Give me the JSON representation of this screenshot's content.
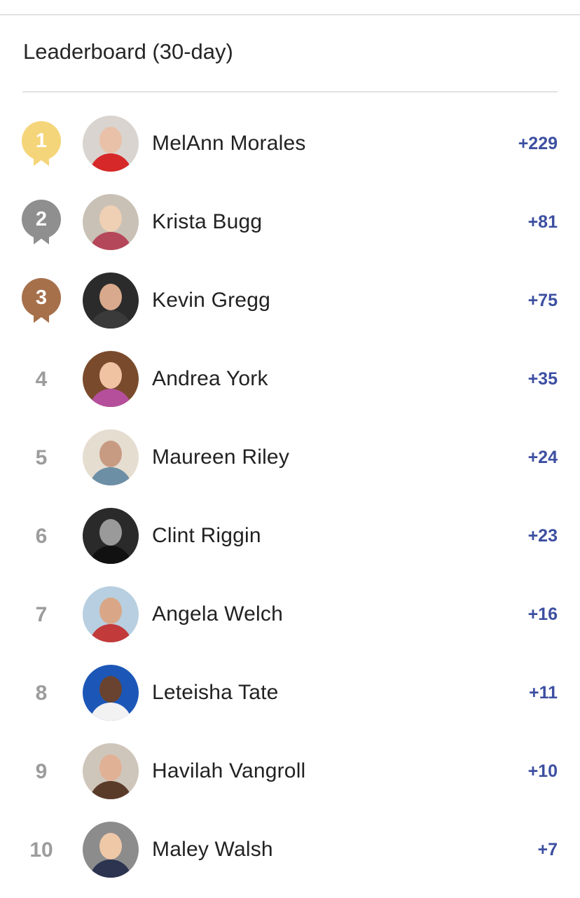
{
  "leaderboard": {
    "title": "Leaderboard (30-day)",
    "medal_colors": {
      "gold": "#f5d57a",
      "silver": "#8f8f8f",
      "bronze": "#a6704b"
    },
    "points_color": "#3d4fa1",
    "rows": [
      {
        "rank": "1",
        "medal": "gold",
        "name": "MelAnn Morales",
        "points": "+229",
        "avatar_colors": [
          "#d9d4cf",
          "#e8c1a8",
          "#d62828"
        ]
      },
      {
        "rank": "2",
        "medal": "silver",
        "name": "Krista Bugg",
        "points": "+81",
        "avatar_colors": [
          "#c9c1b5",
          "#efd0b4",
          "#b5475a"
        ]
      },
      {
        "rank": "3",
        "medal": "bronze",
        "name": "Kevin Gregg",
        "points": "+75",
        "avatar_colors": [
          "#2b2b2b",
          "#d8a98c",
          "#3a3a3a"
        ]
      },
      {
        "rank": "4",
        "medal": "",
        "name": "Andrea York",
        "points": "+35",
        "avatar_colors": [
          "#7a4a2c",
          "#f0c3a2",
          "#b54f9c"
        ]
      },
      {
        "rank": "5",
        "medal": "",
        "name": "Maureen Riley",
        "points": "+24",
        "avatar_colors": [
          "#e5ddd0",
          "#c79b82",
          "#6d8fa6"
        ]
      },
      {
        "rank": "6",
        "medal": "",
        "name": "Clint Riggin",
        "points": "+23",
        "avatar_colors": [
          "#2a2a2a",
          "#9a9a9a",
          "#111111"
        ]
      },
      {
        "rank": "7",
        "medal": "",
        "name": "Angela Welch",
        "points": "+16",
        "avatar_colors": [
          "#b7cfe0",
          "#d9a787",
          "#c23a3a"
        ]
      },
      {
        "rank": "8",
        "medal": "",
        "name": "Leteisha Tate",
        "points": "+11",
        "avatar_colors": [
          "#1c57b8",
          "#6a4330",
          "#f2f2f2"
        ]
      },
      {
        "rank": "9",
        "medal": "",
        "name": "Havilah Vangroll",
        "points": "+10",
        "avatar_colors": [
          "#cfc6bb",
          "#e1b196",
          "#5a3b2a"
        ]
      },
      {
        "rank": "10",
        "medal": "",
        "name": "Maley Walsh",
        "points": "+7",
        "avatar_colors": [
          "#8c8c8c",
          "#efc8a8",
          "#2c3450"
        ]
      }
    ]
  }
}
